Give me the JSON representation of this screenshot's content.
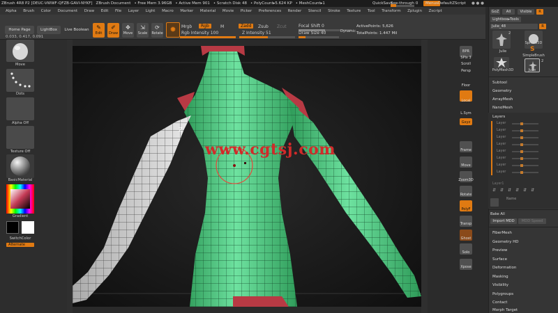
{
  "titlebar": {
    "app": "ZBrush 4R8 P2 [DEUC-VWWF-QFZB-GAVI-NYKF]",
    "document": "ZBrush Document",
    "free_mem": "• Free Mem 3.96GB",
    "active_mem": "• Active Mem 901",
    "scratch": "• Scratch Disk 48",
    "polycount": "• PolyCount▸5.624 KP",
    "meshcount": "• MeshCount▸1",
    "quicksave": "QuickSave",
    "see_through": "See-through",
    "see_through_value": "0",
    "menus": "Menus",
    "default_script": "DefaultZScript"
  },
  "menubar": [
    "Alpha",
    "Brush",
    "Color",
    "Document",
    "Draw",
    "Edit",
    "File",
    "Layer",
    "Light",
    "Macro",
    "Marker",
    "Material",
    "Movie",
    "Picker",
    "Preferences",
    "Render",
    "Stencil",
    "Stroke",
    "Texture",
    "Tool",
    "Transform",
    "Zplugin",
    "Zscript"
  ],
  "shelf": {
    "home_page": "Home Page",
    "lightbox": "LightBox",
    "live_boolean": "Live Boolean",
    "edit": "Edit",
    "draw": "Draw",
    "move": "Move",
    "scale": "Scale",
    "rotate": "Rotate",
    "mrgb": "Mrgb",
    "rgb": "Rgb",
    "m": "M",
    "zadd": "Zadd",
    "zsub": "Zsub",
    "zcut": "Zcut",
    "rgb_intensity": "Rgb Intensity 100",
    "z_intensity": "Z Intensity 51",
    "focal_shift": "Focal Shift 0",
    "draw_size": "Draw Size 40",
    "dynamic": "Dynamic",
    "active_points": "ActivePoints: 5,626",
    "total_points": "TotalPoints: 1.447 Mil"
  },
  "coords": "0.033, 0.417, 0.091",
  "left_palette": {
    "brush": "Move",
    "stroke": "Dots",
    "alpha": "Alpha Off",
    "texture": "Texture Off",
    "material": "BasicMaterial",
    "gradient": "Gradient",
    "switch_color": "SwitchColor",
    "alternate": "Alternate"
  },
  "nav": {
    "bpr": "BPR",
    "spix": "SPix 3",
    "scroll": "Scroll",
    "persp": "Persp",
    "floor": "Floor",
    "local": "Local",
    "lsym": "L.Sym",
    "gxyz": "Gxyz",
    "frame": "Frame",
    "move": "Move",
    "zoom3d": "Zoom3D",
    "rotate": "Rotate",
    "polyf": "PolyF",
    "transp": "Transp",
    "ghost": "Ghost",
    "solo": "Solo",
    "xpose": "Xpose"
  },
  "watermark": "www.cgtsj.com",
  "toolpanel": {
    "goz": "GoZ",
    "all": "All",
    "visible": "Visible",
    "r": "R",
    "lightbox_tools": "Lightbox▸Tools",
    "julie_48": "Julie_48",
    "r_btn": "R",
    "subtools": [
      {
        "name": "Julie",
        "count": "2"
      },
      {
        "name": "Sphere3D",
        "count": ""
      },
      {
        "name": "SimpleBrush",
        "count": ""
      },
      {
        "name": "PolyMesh3D",
        "count": ""
      },
      {
        "name": "Julie",
        "count": "2"
      }
    ],
    "items_top": [
      "Subtool",
      "Geometry",
      "ArrayMesh",
      "NanoMesh"
    ],
    "layers_title": "Layers",
    "layers": [
      "Layer",
      "Layer",
      "Layer",
      "Layer",
      "Layer",
      "Layer",
      "Layer",
      "Layer"
    ],
    "layer_current": "Layer1",
    "layer_name": "Name",
    "bake_all": "Bake All",
    "import_mdd": "Import MDD",
    "mdd_speed": "MDD Speed",
    "items_bottom": [
      "FiberMesh",
      "Geometry HD",
      "Preview",
      "Surface",
      "Deformation",
      "Masking",
      "Visibility",
      "Polygroups",
      "Contact",
      "Morph Target"
    ]
  },
  "colors": {
    "accent": "#e07a12",
    "mesh_green": "#4fcf86",
    "mesh_red": "#b83a44"
  }
}
